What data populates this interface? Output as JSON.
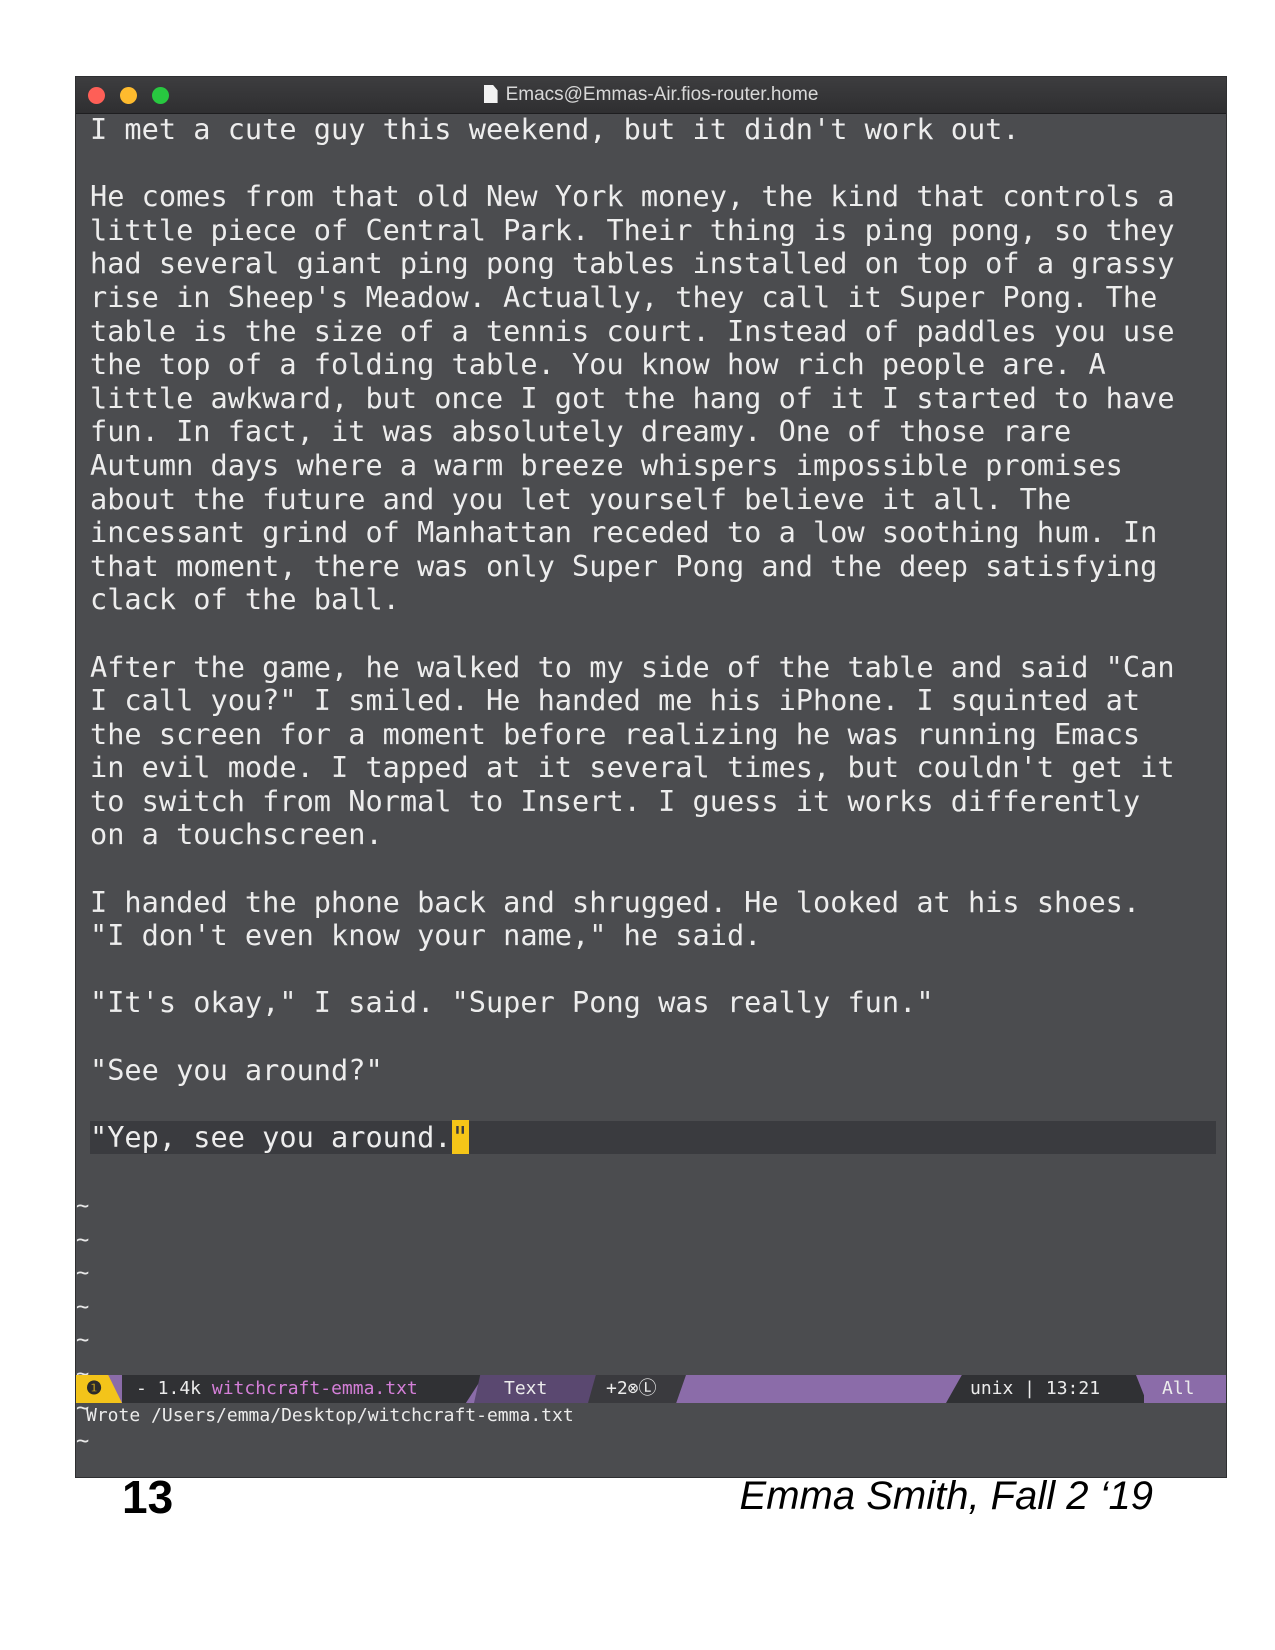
{
  "window": {
    "title": "Emacs@Emmas-Air.fios-router.home"
  },
  "buffer": {
    "lines": [
      "I met a cute guy this weekend, but it didn't work out.",
      "",
      "He comes from that old New York money, the kind that controls a",
      "little piece of Central Park. Their thing is ping pong, so they",
      "had several giant ping pong tables installed on top of a grassy",
      "rise in Sheep's Meadow. Actually, they call it Super Pong. The",
      "table is the size of a tennis court. Instead of paddles you use",
      "the top of a folding table. You know how rich people are. A",
      "little awkward, but once I got the hang of it I started to have",
      "fun. In fact, it was absolutely dreamy. One of those rare",
      "Autumn days where a warm breeze whispers impossible promises",
      "about the future and you let yourself believe it all. The",
      "incessant grind of Manhattan receded to a low soothing hum. In",
      "that moment, there was only Super Pong and the deep satisfying",
      "clack of the ball.",
      "",
      "After the game, he walked to my side of the table and said \"Can",
      "I call you?\" I smiled. He handed me his iPhone. I squinted at",
      "the screen for a moment before realizing he was running Emacs",
      "in evil mode. I tapped at it several times, but couldn't get it",
      "to switch from Normal to Insert. I guess it works differently",
      "on a touchscreen.",
      "",
      "I handed the phone back and shrugged. He looked at his shoes.",
      "\"I don't even know your name,\" he said.",
      "",
      "\"It's okay,\" I said. \"Super Pong was really fun.\"",
      "",
      "\"See you around?\"",
      ""
    ],
    "current_line_text": "\"Yep, see you around.",
    "cursor_char": "\"",
    "empty_line_markers": [
      "~",
      "~",
      "~",
      "~",
      "~",
      "~",
      "~",
      "~"
    ]
  },
  "modeline": {
    "state": "❶",
    "size": "- 1.4k ",
    "filename": "witchcraft-emma.txt",
    "major_mode": "Text",
    "minor_modes": "+2⊗Ⓛ",
    "encoding_position": "unix | 13:21",
    "scroll": "All",
    "colors": {
      "bar": "#8b6ca9",
      "state": "#f3c41a",
      "filename": "#d47fd8"
    }
  },
  "echo_area": {
    "message": "Wrote /Users/emma/Desktop/witchcraft-emma.txt"
  },
  "page": {
    "number": "13",
    "credit": "Emma Smith, Fall 2 ‘19"
  }
}
